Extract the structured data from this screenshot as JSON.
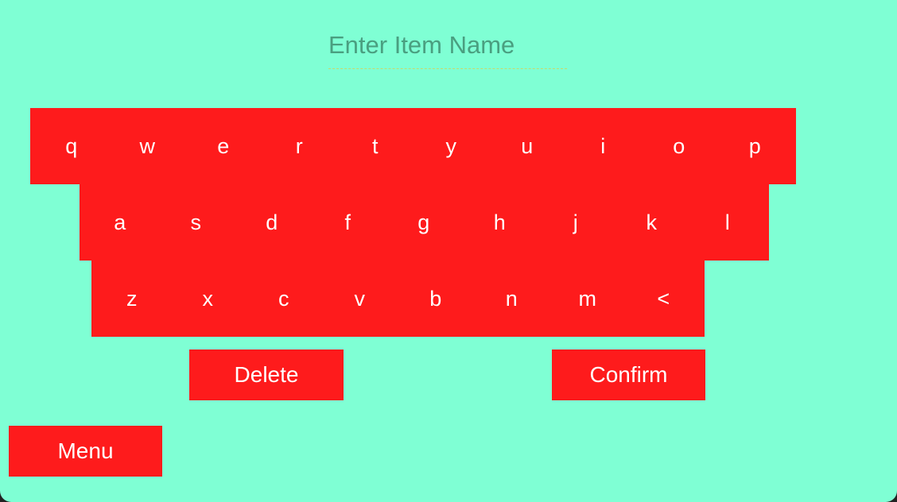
{
  "input": {
    "value": "",
    "placeholder": "Enter Item Name"
  },
  "keyboard": {
    "row1": [
      "q",
      "w",
      "e",
      "r",
      "t",
      "y",
      "u",
      "i",
      "o",
      "p"
    ],
    "row2": [
      "a",
      "s",
      "d",
      "f",
      "g",
      "h",
      "j",
      "k",
      "l"
    ],
    "row3": [
      "z",
      "x",
      "c",
      "v",
      "b",
      "n",
      "m",
      "<"
    ]
  },
  "actions": {
    "delete_label": "Delete",
    "confirm_label": "Confirm",
    "menu_label": "Menu"
  },
  "colors": {
    "background": "#7fffd4",
    "key_background": "#fe1b1c",
    "key_text": "#ffffff",
    "placeholder": "#4a9f80",
    "underline": "#c8d96a"
  }
}
